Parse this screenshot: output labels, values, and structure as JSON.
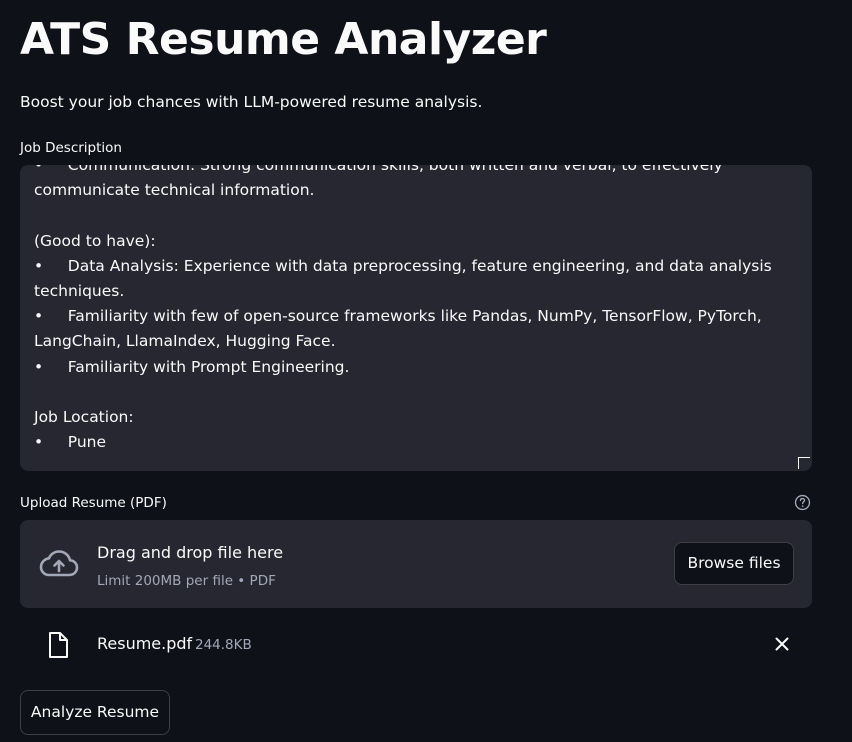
{
  "app": {
    "title": "ATS Resume Analyzer",
    "subtitle": "Boost your job chances with LLM-powered resume analysis."
  },
  "job_description": {
    "label": "Job Description",
    "text": "•     Communication: Strong communication skills, both written and verbal, to effectively communicate technical information.\n\n(Good to have):\n•     Data Analysis: Experience with data preprocessing, feature engineering, and data analysis techniques.\n•     Familiarity with few of open-source frameworks like Pandas, NumPy, TensorFlow, PyTorch, LangChain, LlamaIndex, Hugging Face.\n•     Familiarity with Prompt Engineering.\n\nJob Location:\n•     Pune"
  },
  "upload": {
    "label": "Upload Resume (PDF)",
    "help_icon": "question-circle-icon",
    "drop_title": "Drag and drop file here",
    "drop_limit": "Limit 200MB per file • PDF",
    "browse_label": "Browse files",
    "upload_icon": "cloud-upload-icon"
  },
  "uploaded_file": {
    "name": "Resume.pdf",
    "size": "244.8KB",
    "file_icon": "file-icon",
    "remove_icon": "close-icon"
  },
  "actions": {
    "analyze_label": "Analyze Resume"
  },
  "colors": {
    "background": "#0e1117",
    "surface": "#262730",
    "text": "#fafafa",
    "muted": "#a3a8b8"
  }
}
